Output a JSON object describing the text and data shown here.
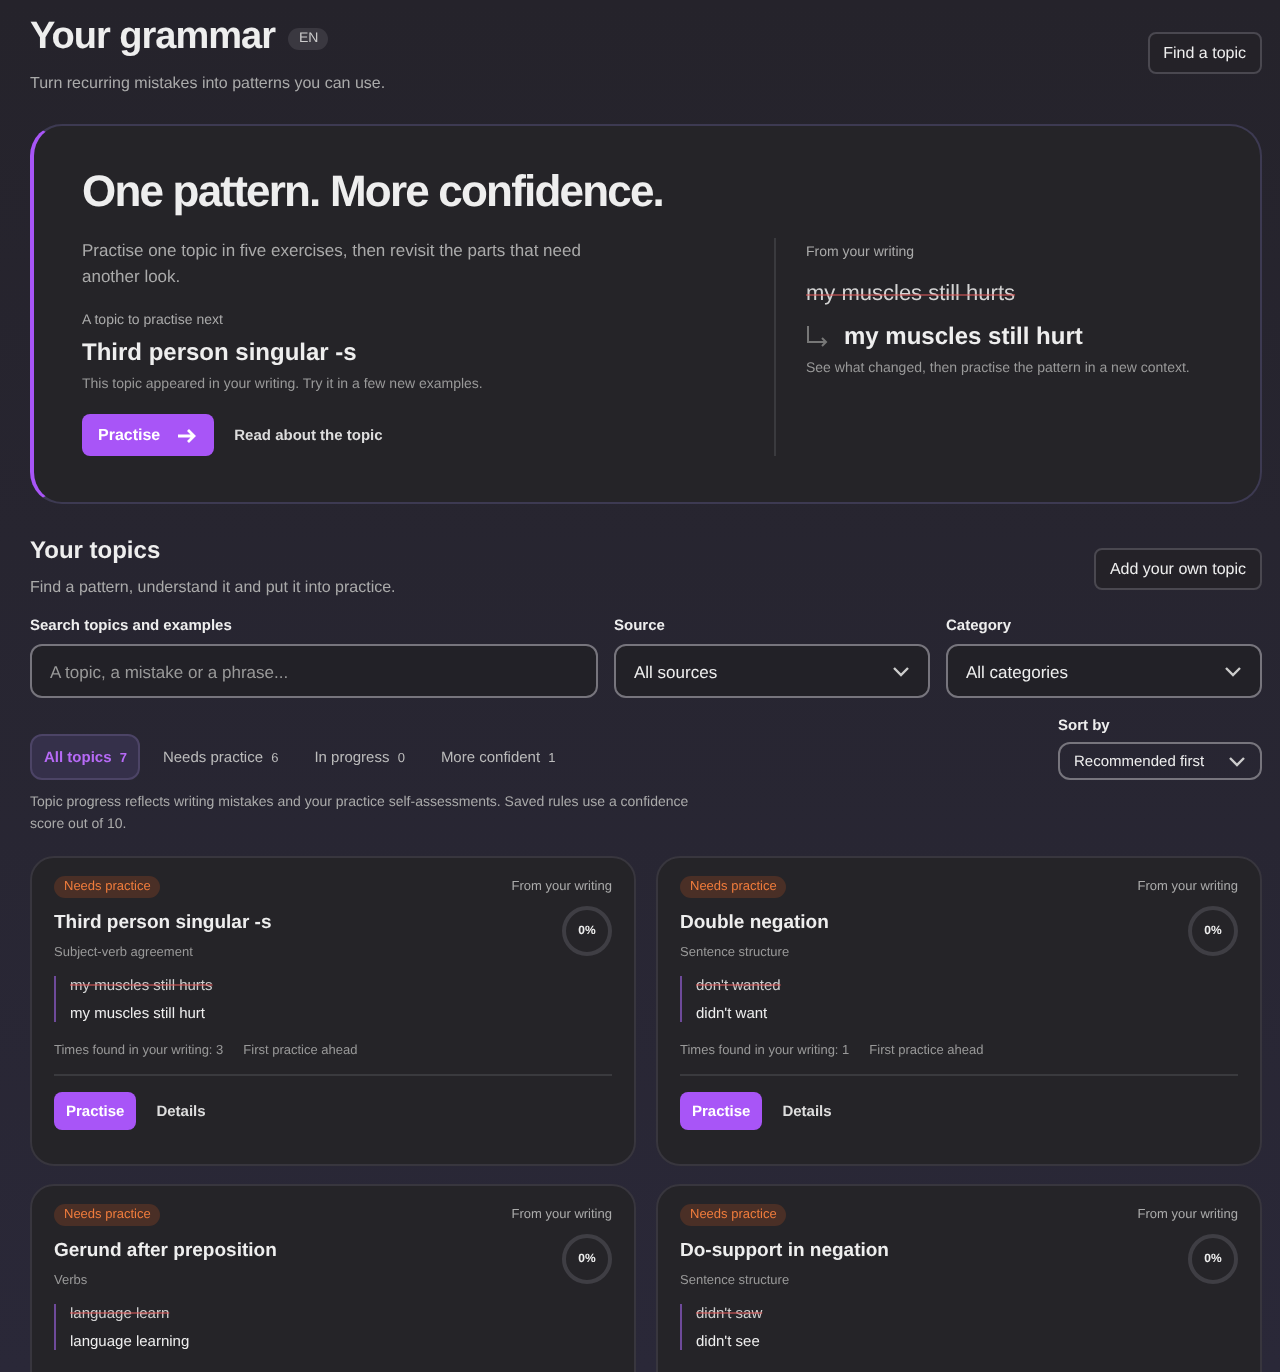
{
  "header": {
    "title": "Your grammar",
    "language_badge": "EN",
    "subtitle": "Turn recurring mistakes into patterns you can use.",
    "find_button": "Find a topic"
  },
  "hero": {
    "headline": "One pattern. More confidence.",
    "intro": "Practise one topic in five exercises, then revisit the parts that need another look.",
    "next_label": "A topic to practise next",
    "topic": "Third person singular -s",
    "topic_note": "This topic appeared in your writing. Try it in a few new examples.",
    "practise_button": "Practise",
    "read_link": "Read about the topic",
    "example_label": "From your writing",
    "mistake": "my muscles still hurts",
    "correction": "my muscles still hurt",
    "example_note": "See what changed, then practise the pattern in a new context."
  },
  "topics": {
    "title": "Your topics",
    "subtitle": "Find a pattern, understand it and put it into practice.",
    "add_button": "Add your own topic",
    "search": {
      "label": "Search topics and examples",
      "placeholder": "A topic, a mistake or a phrase..."
    },
    "source": {
      "label": "Source",
      "value": "All sources"
    },
    "category": {
      "label": "Category",
      "value": "All categories"
    },
    "sort": {
      "label": "Sort by",
      "value": "Recommended first"
    },
    "tabs": [
      {
        "label": "All topics",
        "count": "7",
        "selected": true
      },
      {
        "label": "Needs practice",
        "count": "6",
        "selected": false
      },
      {
        "label": "In progress",
        "count": "0",
        "selected": false
      },
      {
        "label": "More confident",
        "count": "1",
        "selected": false
      }
    ],
    "note": "Topic progress reflects writing mistakes and your practice self-assessments. Saved rules use a confidence score out of 10.",
    "cards": [
      {
        "status": "Needs practice",
        "source": "From your writing",
        "title": "Third person singular -s",
        "category": "Subject-verb agreement",
        "progress": "0%",
        "mistake": "my muscles still hurts",
        "correction": "my muscles still hurt",
        "found": "Times found in your writing: 3",
        "next": "First practice ahead",
        "practise_button": "Practise",
        "details_link": "Details"
      },
      {
        "status": "Needs practice",
        "source": "From your writing",
        "title": "Double negation",
        "category": "Sentence structure",
        "progress": "0%",
        "mistake": "don't wanted",
        "correction": "didn't want",
        "found": "Times found in your writing: 1",
        "next": "First practice ahead",
        "practise_button": "Practise",
        "details_link": "Details"
      },
      {
        "status": "Needs practice",
        "source": "From your writing",
        "title": "Gerund after preposition",
        "category": "Verbs",
        "progress": "0%",
        "mistake": "language learn",
        "correction": "language learning"
      },
      {
        "status": "Needs practice",
        "source": "From your writing",
        "title": "Do-support in negation",
        "category": "Sentence structure",
        "progress": "0%",
        "mistake": "didn't saw",
        "correction": "didn't see"
      }
    ]
  }
}
